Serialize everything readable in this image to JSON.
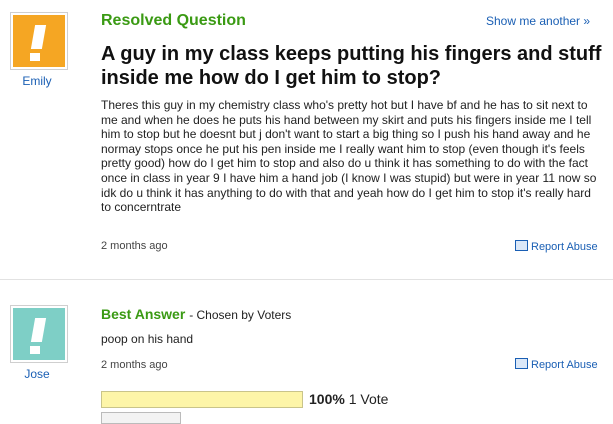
{
  "question": {
    "status_label": "Resolved Question",
    "show_another": "Show me another »",
    "user_name": "Emily",
    "avatar_color": "#f5a623",
    "title": "A guy in my class keeps putting his fingers and stuff inside me how do I get him to stop?",
    "body": "Theres this guy in my chemistry class who's pretty hot but I have bf and he has to sit next to me and when he does he puts his hand between my skirt and puts his fingers inside me I tell him to stop but he doesnt but j don't want to start a big thing so I push his hand away and he normay stops once he put his pen inside me I really want him to stop (even though it's feels pretty good) how do I get him to stop and also do u think it has something to do with the fact once in class in year 9 I have him a hand job (I know I was stupid) but were in year 11 now so idk do u think it has anything to do with that and yeah how do I get him to stop it's really hard to concerntrate",
    "timestamp": "2 months ago",
    "report_abuse": "Report Abuse"
  },
  "answer": {
    "label": "Best Answer",
    "chosen_by": "- Chosen by Voters",
    "user_name": "Jose",
    "avatar_color": "#7ecfc6",
    "text": "poop on his hand",
    "timestamp": "2 months ago",
    "report_abuse": "Report Abuse",
    "vote_percent_label": "100%",
    "vote_count_label": "1 Vote",
    "vote_fraction": 1.0
  }
}
